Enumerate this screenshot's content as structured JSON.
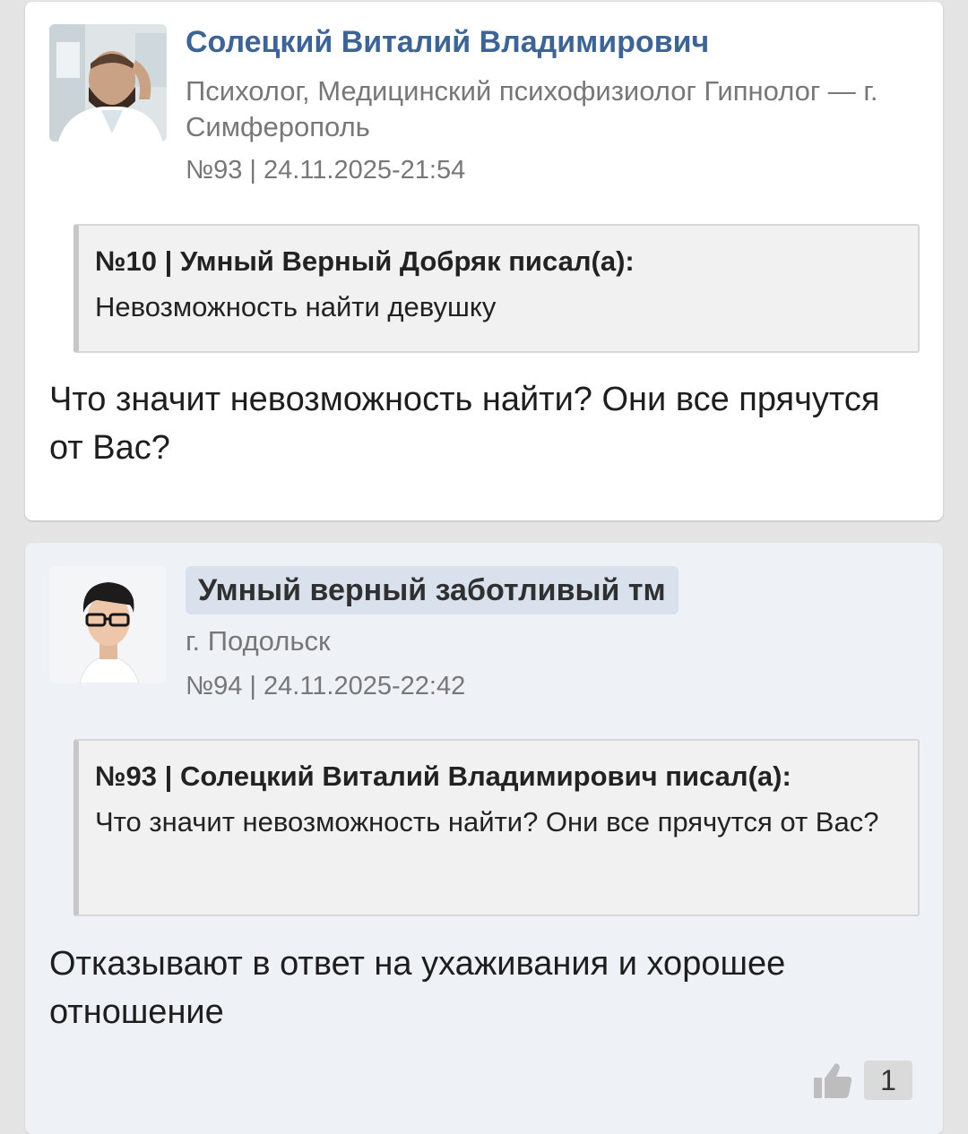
{
  "posts": [
    {
      "author": "Солецкий Виталий Владимирович",
      "role": "Психолог, Медицинский психофизиолог Гипнолог — г. Симферополь",
      "meta": "№93 | 24.11.2025-21:54",
      "quote": {
        "head": "№10 | Умный Верный Добряк писал(а):",
        "text": "Невозможность найти девушку"
      },
      "body": "Что значит невозможность найти? Они все прячутся от Вас?"
    },
    {
      "author": "Умный верный заботливый тм",
      "city": "г. Подольск",
      "meta": "№94 | 24.11.2025-22:42",
      "quote": {
        "head": "№93 | Солецкий Виталий Владимирович писал(а):",
        "text": "Что значит невозможность найти? Они все прячутся от Вас?"
      },
      "body": "Отказывают в ответ на ухаживания и хорошее отношение",
      "likes": "1"
    }
  ],
  "icons": {
    "like": "thumbs-up-icon"
  },
  "colors": {
    "author_link": "#3d6495",
    "badge_bg": "#d8e1ec",
    "post_highlight_bg": "#eef1f6",
    "quote_bg": "#f1f1f1",
    "page_bg": "#e4e4e4"
  }
}
